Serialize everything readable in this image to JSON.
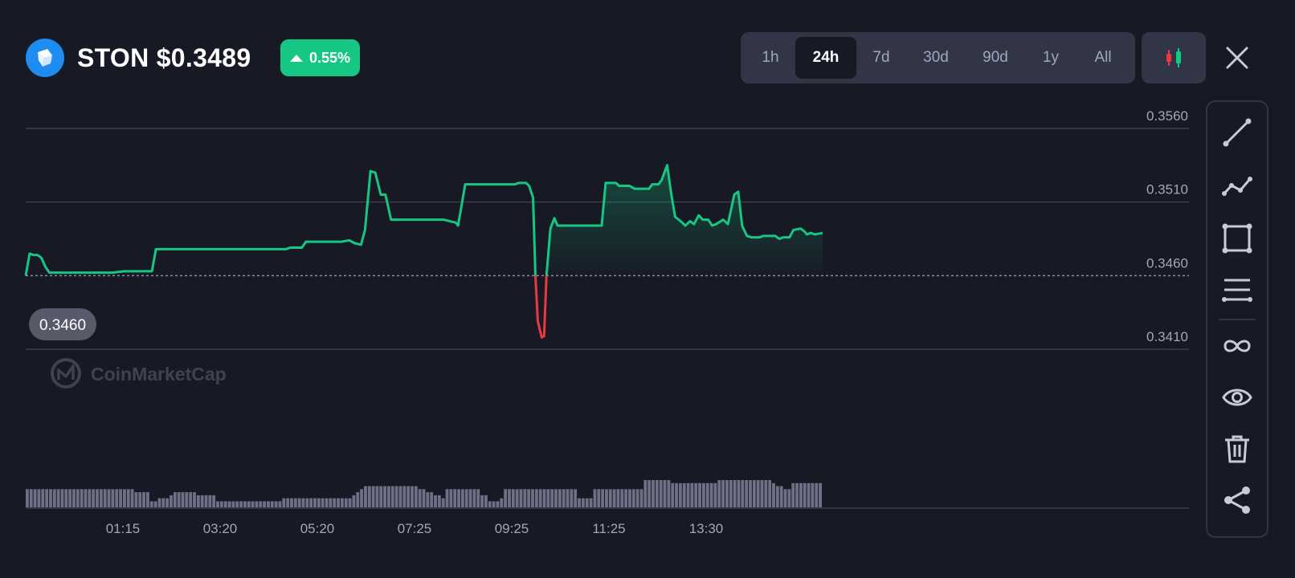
{
  "header": {
    "coin_title": "STON $0.3489",
    "change_percent": "0.55%",
    "change_direction": "up",
    "logo_icon": "ston-logo-icon"
  },
  "time_ranges": {
    "options": [
      "1h",
      "24h",
      "7d",
      "30d",
      "90d",
      "1y",
      "All"
    ],
    "selected": "24h"
  },
  "buttons": {
    "chart_type_icon": "candlestick-icon",
    "close_icon": "close-icon"
  },
  "colors": {
    "background": "#171924",
    "up": "#16c784",
    "down": "#ea3943",
    "panel": "#323546"
  },
  "watermark": "CoinMarketCap",
  "open_price_label": "0.3460",
  "chart_data": {
    "type": "line",
    "y_tick_labels": [
      "0.3560",
      "0.3510",
      "0.3460",
      "0.3410"
    ],
    "x_tick_labels": [
      "01:15",
      "03:20",
      "05:20",
      "07:25",
      "09:25",
      "11:25",
      "13:30"
    ],
    "ylim": [
      0.341,
      0.356
    ],
    "baseline": 0.346,
    "price_points": [
      [
        0.0,
        0.346
      ],
      [
        0.5,
        0.3475
      ],
      [
        1.0,
        0.3474
      ],
      [
        1.5,
        0.3474
      ],
      [
        2.0,
        0.3472
      ],
      [
        2.5,
        0.3466
      ],
      [
        3.0,
        0.3462
      ],
      [
        5.0,
        0.3462
      ],
      [
        8.0,
        0.3462
      ],
      [
        11.0,
        0.3462
      ],
      [
        12.5,
        0.3463
      ],
      [
        15.0,
        0.3463
      ],
      [
        16.0,
        0.3463
      ],
      [
        16.5,
        0.3478
      ],
      [
        20.0,
        0.3478
      ],
      [
        25.0,
        0.3478
      ],
      [
        30.0,
        0.3478
      ],
      [
        33.0,
        0.3478
      ],
      [
        33.5,
        0.3479
      ],
      [
        35.0,
        0.3479
      ],
      [
        35.5,
        0.3483
      ],
      [
        38.0,
        0.3483
      ],
      [
        40.0,
        0.3483
      ],
      [
        41.0,
        0.3484
      ],
      [
        41.7,
        0.3482
      ],
      [
        42.5,
        0.3481
      ],
      [
        43.0,
        0.3491
      ],
      [
        43.7,
        0.3531
      ],
      [
        44.3,
        0.353
      ],
      [
        45.0,
        0.3515
      ],
      [
        45.6,
        0.3515
      ],
      [
        46.3,
        0.3498
      ],
      [
        52.0,
        0.3498
      ],
      [
        53.0,
        0.3498
      ],
      [
        54.5,
        0.3496
      ],
      [
        54.8,
        0.3494
      ],
      [
        55.7,
        0.3522
      ],
      [
        60.0,
        0.3522
      ],
      [
        62.0,
        0.3522
      ],
      [
        62.5,
        0.3523
      ],
      [
        63.4,
        0.3523
      ],
      [
        63.8,
        0.3521
      ],
      [
        64.3,
        0.3513
      ],
      [
        64.6,
        0.346
      ],
      [
        64.9,
        0.3429
      ],
      [
        65.4,
        0.3418
      ],
      [
        65.7,
        0.3419
      ],
      [
        66.0,
        0.346
      ],
      [
        66.5,
        0.3492
      ],
      [
        67.0,
        0.3499
      ],
      [
        67.4,
        0.3494
      ],
      [
        70.0,
        0.3494
      ],
      [
        73.0,
        0.3494
      ],
      [
        73.5,
        0.3523
      ],
      [
        74.8,
        0.3523
      ],
      [
        75.2,
        0.3521
      ],
      [
        76.5,
        0.3521
      ],
      [
        77.2,
        0.3519
      ],
      [
        79.0,
        0.3519
      ],
      [
        79.4,
        0.3522
      ],
      [
        80.2,
        0.3522
      ],
      [
        80.6,
        0.3525
      ],
      [
        81.3,
        0.3535
      ],
      [
        81.8,
        0.3516
      ],
      [
        82.3,
        0.35
      ],
      [
        83.0,
        0.3497
      ],
      [
        83.6,
        0.3494
      ],
      [
        84.2,
        0.3497
      ],
      [
        84.7,
        0.3495
      ],
      [
        85.3,
        0.3501
      ],
      [
        85.8,
        0.3498
      ],
      [
        86.5,
        0.3498
      ],
      [
        87.0,
        0.3494
      ],
      [
        87.5,
        0.3495
      ],
      [
        88.4,
        0.3498
      ],
      [
        89.0,
        0.3495
      ],
      [
        89.8,
        0.3515
      ],
      [
        90.3,
        0.3517
      ],
      [
        90.8,
        0.3494
      ],
      [
        91.4,
        0.3487
      ],
      [
        92.0,
        0.3486
      ],
      [
        93.0,
        0.3486
      ],
      [
        93.5,
        0.3487
      ],
      [
        95.0,
        0.3487
      ],
      [
        95.5,
        0.3485
      ],
      [
        96.0,
        0.3486
      ],
      [
        96.8,
        0.3486
      ],
      [
        97.3,
        0.3491
      ],
      [
        98.2,
        0.3492
      ],
      [
        98.7,
        0.349
      ],
      [
        99.0,
        0.3488
      ],
      [
        99.5,
        0.3489
      ],
      [
        100.0,
        0.3488
      ],
      [
        101.0,
        0.3489
      ]
    ],
    "volume": [
      6,
      6,
      6,
      6,
      6,
      6,
      6,
      6,
      6,
      6,
      6,
      6,
      6,
      6,
      6,
      6,
      6,
      6,
      6,
      6,
      6,
      6,
      6,
      6,
      6,
      6,
      6,
      6,
      5,
      5,
      5,
      5,
      2,
      2,
      3,
      3,
      3,
      4,
      5,
      5,
      5,
      5,
      5,
      5,
      4,
      4,
      4,
      4,
      4,
      2,
      2,
      2,
      2,
      2,
      2,
      2,
      2,
      2,
      2,
      2,
      2,
      2,
      2,
      2,
      2,
      2,
      3,
      3,
      3,
      3,
      3,
      3,
      3,
      3,
      3,
      3,
      3,
      3,
      3,
      3,
      3,
      3,
      3,
      3,
      4,
      5,
      6,
      7,
      7,
      7,
      7,
      7,
      7,
      7,
      7,
      7,
      7,
      7,
      7,
      7,
      7,
      6,
      6,
      5,
      5,
      4,
      4,
      3,
      6,
      6,
      6,
      6,
      6,
      6,
      6,
      6,
      6,
      4,
      4,
      2,
      2,
      2,
      3,
      6,
      6,
      6,
      6,
      6,
      6,
      6,
      6,
      6,
      6,
      6,
      6,
      6,
      6,
      6,
      6,
      6,
      6,
      6,
      3,
      3,
      3,
      3,
      6,
      6,
      6,
      6,
      6,
      6,
      6,
      6,
      6,
      6,
      6,
      6,
      6,
      9,
      9,
      9,
      9,
      9,
      9,
      9,
      8,
      8,
      8,
      8,
      8,
      8,
      8,
      8,
      8,
      8,
      8,
      8,
      9,
      9,
      9,
      9,
      9,
      9,
      9,
      9,
      9,
      9,
      9,
      9,
      9,
      9,
      8,
      7,
      7,
      6,
      6,
      8,
      8,
      8,
      8,
      8,
      8,
      8,
      8
    ]
  },
  "toolbar": {
    "tools": [
      "trend-line-icon",
      "multi-line-icon",
      "rectangle-icon",
      "parallel-lines-icon",
      "infinity-icon",
      "eye-icon",
      "trash-icon",
      "share-icon"
    ]
  }
}
